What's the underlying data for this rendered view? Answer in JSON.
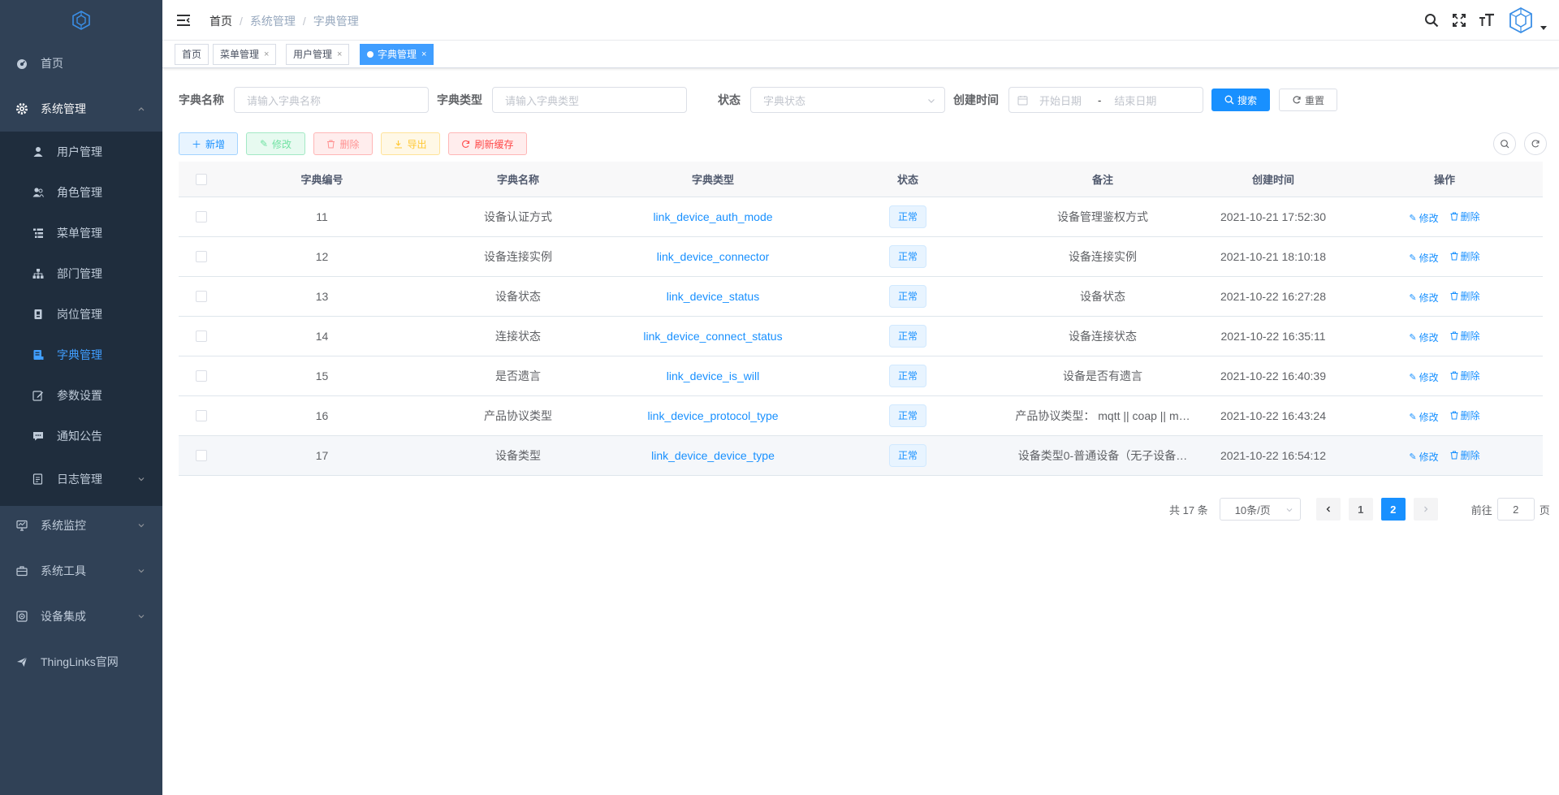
{
  "sidebar": {
    "logo_icon": "thinglinks-logo-icon",
    "items": [
      {
        "label": "首页",
        "icon": "dashboard-icon"
      },
      {
        "label": "系统管理",
        "icon": "gear-icon",
        "open": true,
        "children": [
          {
            "label": "用户管理",
            "icon": "user-icon"
          },
          {
            "label": "角色管理",
            "icon": "peoples-icon"
          },
          {
            "label": "菜单管理",
            "icon": "tree-table-icon"
          },
          {
            "label": "部门管理",
            "icon": "tree-icon"
          },
          {
            "label": "岗位管理",
            "icon": "post-icon"
          },
          {
            "label": "字典管理",
            "icon": "dict-icon",
            "active": true
          },
          {
            "label": "参数设置",
            "icon": "edit-icon"
          },
          {
            "label": "通知公告",
            "icon": "message-icon"
          },
          {
            "label": "日志管理",
            "icon": "log-icon"
          }
        ]
      },
      {
        "label": "系统监控",
        "icon": "monitor-icon"
      },
      {
        "label": "系统工具",
        "icon": "tool-icon"
      },
      {
        "label": "设备集成",
        "icon": "device-icon"
      },
      {
        "label": "ThingLinks官网",
        "icon": "guide-icon"
      }
    ]
  },
  "navbar": {
    "breadcrumb": [
      "首页",
      "系统管理",
      "字典管理"
    ]
  },
  "tags": [
    {
      "label": "首页",
      "closable": false
    },
    {
      "label": "菜单管理",
      "closable": true
    },
    {
      "label": "用户管理",
      "closable": true
    },
    {
      "label": "字典管理",
      "closable": true,
      "active": true
    }
  ],
  "search": {
    "dict_name_label": "字典名称",
    "dict_name_placeholder": "请输入字典名称",
    "dict_type_label": "字典类型",
    "dict_type_placeholder": "请输入字典类型",
    "status_label": "状态",
    "status_placeholder": "字典状态",
    "created_label": "创建时间",
    "start_placeholder": "开始日期",
    "range_sep": "-",
    "end_placeholder": "结束日期",
    "search_btn": "搜索",
    "reset_btn": "重置"
  },
  "toolbar": {
    "add": "新增",
    "edit": "修改",
    "delete": "删除",
    "export": "导出",
    "refresh_cache": "刷新缓存"
  },
  "table": {
    "headers": [
      "字典编号",
      "字典名称",
      "字典类型",
      "状态",
      "备注",
      "创建时间",
      "操作"
    ],
    "rows": [
      {
        "id": "11",
        "name": "设备认证方式",
        "type": "link_device_auth_mode",
        "status": "正常",
        "remark": "设备管理鉴权方式",
        "created": "2021-10-21 17:52:30"
      },
      {
        "id": "12",
        "name": "设备连接实例",
        "type": "link_device_connector",
        "status": "正常",
        "remark": "设备连接实例",
        "created": "2021-10-21 18:10:18"
      },
      {
        "id": "13",
        "name": "设备状态",
        "type": "link_device_status",
        "status": "正常",
        "remark": "设备状态",
        "created": "2021-10-22 16:27:28"
      },
      {
        "id": "14",
        "name": "连接状态",
        "type": "link_device_connect_status",
        "status": "正常",
        "remark": "设备连接状态",
        "created": "2021-10-22 16:35:11"
      },
      {
        "id": "15",
        "name": "是否遗言",
        "type": "link_device_is_will",
        "status": "正常",
        "remark": "设备是否有遗言",
        "created": "2021-10-22 16:40:39"
      },
      {
        "id": "16",
        "name": "产品协议类型",
        "type": "link_device_protocol_type",
        "status": "正常",
        "remark": "产品协议类型： mqtt || coap || m…",
        "created": "2021-10-22 16:43:24"
      },
      {
        "id": "17",
        "name": "设备类型",
        "type": "link_device_device_type",
        "status": "正常",
        "remark": "设备类型0-普通设备（无子设备…",
        "created": "2021-10-22 16:54:12"
      }
    ],
    "op_edit": "修改",
    "op_delete": "删除"
  },
  "pagination": {
    "total": "共 17 条",
    "page_size": "10条/页",
    "pages": [
      "1",
      "2"
    ],
    "current": "2",
    "goto_label": "前往",
    "goto_value": "2",
    "page_unit": "页"
  },
  "colors": {
    "sidebar_bg": "#304156",
    "submenu_bg": "#1f2d3d",
    "primary": "#1890ff",
    "tag_active": "#409eff"
  }
}
